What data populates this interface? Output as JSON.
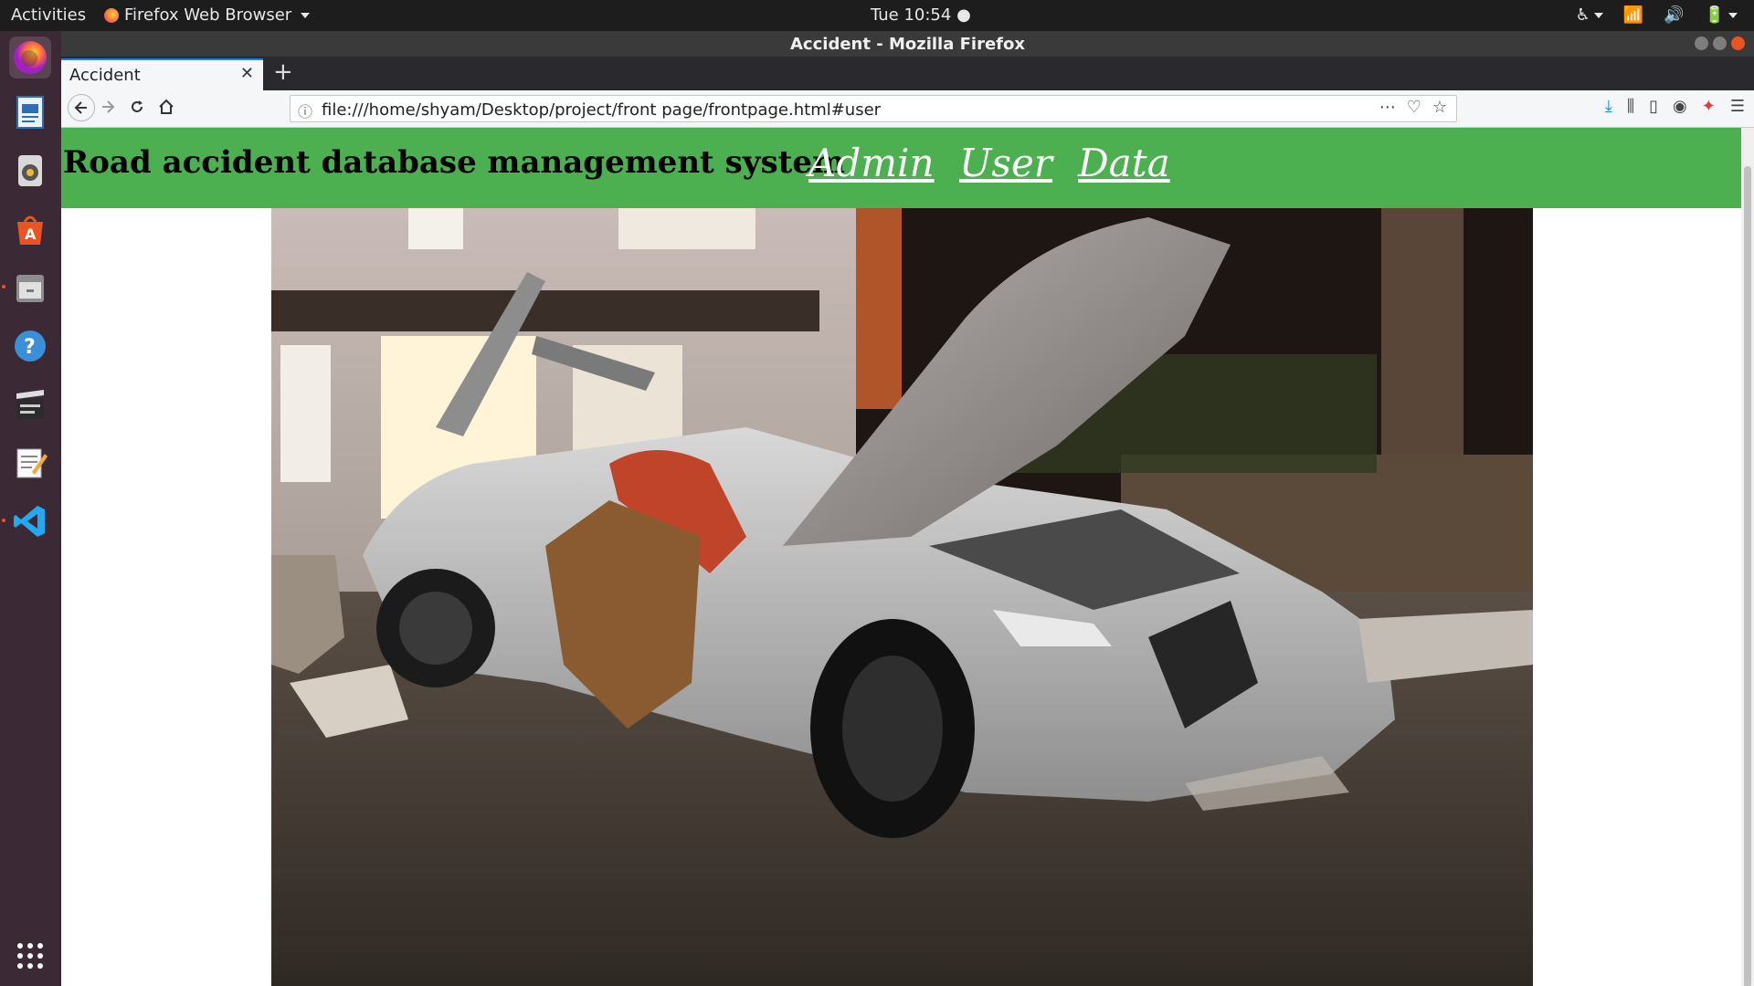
{
  "topbar": {
    "activities": "Activities",
    "app_menu": "Firefox Web Browser",
    "clock": "Tue 10:54"
  },
  "window": {
    "title": "Accident - Mozilla Firefox"
  },
  "browser": {
    "tab_title": "Accident",
    "url": "file:///home/shyam/Desktop/project/front page/frontpage.html#user"
  },
  "page": {
    "site_title": "Road accident database management system",
    "nav": [
      "Admin",
      "User",
      "Data"
    ],
    "header_color": "#4caf50",
    "photo_subject": "crashed silver car"
  },
  "dock": {
    "items": [
      "firefox-icon",
      "writer-icon",
      "rhythmbox-icon",
      "software-center-icon",
      "files-icon",
      "help-icon",
      "video-icon",
      "text-editor-icon",
      "vscode-icon",
      "show-apps-icon"
    ]
  }
}
